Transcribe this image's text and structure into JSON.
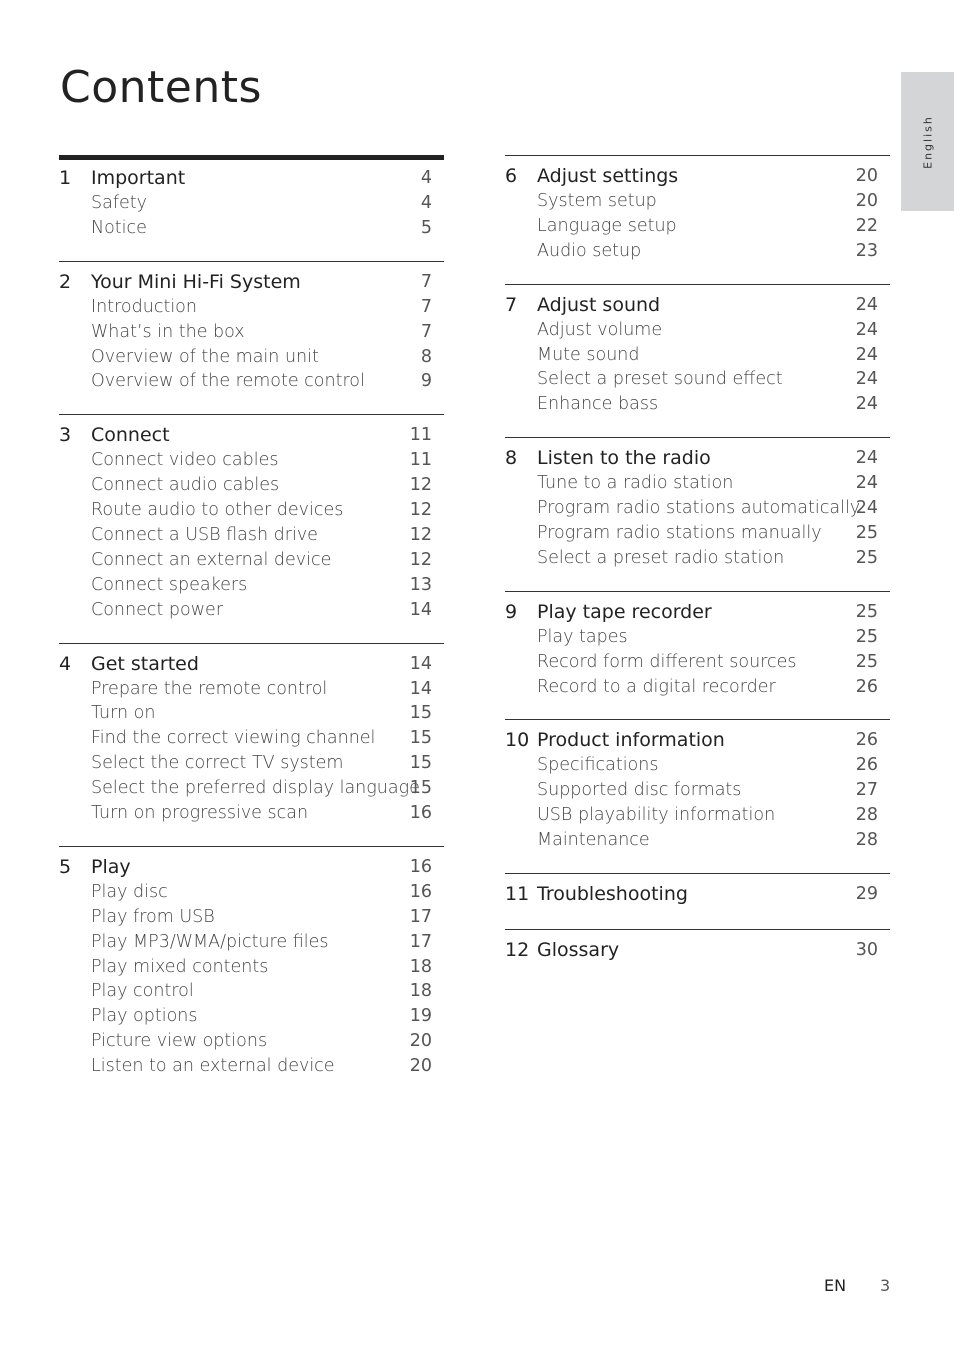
{
  "page": {
    "title": "Contents",
    "language_tab": "English",
    "footer": {
      "language": "EN",
      "page_number": "3"
    }
  },
  "sections": [
    {
      "num": "1",
      "title": "Important",
      "page": "4",
      "items": [
        {
          "title": "Safety",
          "page": "4"
        },
        {
          "title": "Notice",
          "page": "5"
        }
      ]
    },
    {
      "num": "2",
      "title": "Your Mini Hi-Fi System",
      "page": "7",
      "items": [
        {
          "title": "Introduction",
          "page": "7"
        },
        {
          "title": "What’s in the box",
          "page": "7"
        },
        {
          "title": "Overview of the main unit",
          "page": "8"
        },
        {
          "title": "Overview of the remote control",
          "page": "9"
        }
      ]
    },
    {
      "num": "3",
      "title": "Connect",
      "page": "11",
      "items": [
        {
          "title": "Connect video cables",
          "page": "11"
        },
        {
          "title": "Connect audio cables",
          "page": "12"
        },
        {
          "title": "Route audio to other devices",
          "page": "12"
        },
        {
          "title": "Connect a USB flash drive",
          "page": "12"
        },
        {
          "title": "Connect an external device",
          "page": "12"
        },
        {
          "title": "Connect speakers",
          "page": "13"
        },
        {
          "title": "Connect power",
          "page": "14"
        }
      ]
    },
    {
      "num": "4",
      "title": "Get started",
      "page": "14",
      "items": [
        {
          "title": "Prepare the remote control",
          "page": "14"
        },
        {
          "title": "Turn on",
          "page": "15"
        },
        {
          "title": "Find the correct viewing channel",
          "page": "15"
        },
        {
          "title": "Select the correct TV system",
          "page": "15"
        },
        {
          "title": "Select the preferred display language",
          "page": "15"
        },
        {
          "title": "Turn on progressive scan",
          "page": "16"
        }
      ]
    },
    {
      "num": "5",
      "title": "Play",
      "page": "16",
      "items": [
        {
          "title": "Play disc",
          "page": "16"
        },
        {
          "title": "Play from USB",
          "page": "17"
        },
        {
          "title": "Play MP3/WMA/picture files",
          "page": "17"
        },
        {
          "title": "Play mixed contents",
          "page": "18"
        },
        {
          "title": "Play control",
          "page": "18"
        },
        {
          "title": "Play options",
          "page": "19"
        },
        {
          "title": "Picture view options",
          "page": "20"
        },
        {
          "title": "Listen to an external device",
          "page": "20"
        }
      ]
    },
    {
      "num": "6",
      "title": "Adjust settings",
      "page": "20",
      "items": [
        {
          "title": "System setup",
          "page": "20"
        },
        {
          "title": "Language setup",
          "page": "22"
        },
        {
          "title": "Audio setup",
          "page": "23"
        }
      ]
    },
    {
      "num": "7",
      "title": "Adjust sound",
      "page": "24",
      "items": [
        {
          "title": "Adjust volume",
          "page": "24"
        },
        {
          "title": "Mute sound",
          "page": "24"
        },
        {
          "title": "Select a preset sound effect",
          "page": "24"
        },
        {
          "title": "Enhance bass",
          "page": "24"
        }
      ]
    },
    {
      "num": "8",
      "title": "Listen to the radio",
      "page": "24",
      "items": [
        {
          "title": "Tune to a radio station",
          "page": "24"
        },
        {
          "title": "Program radio stations automatically",
          "page": "24"
        },
        {
          "title": "Program radio stations manually",
          "page": "25"
        },
        {
          "title": "Select a preset radio station",
          "page": "25"
        }
      ]
    },
    {
      "num": "9",
      "title": "Play tape recorder",
      "page": "25",
      "items": [
        {
          "title": "Play tapes",
          "page": "25"
        },
        {
          "title": "Record form different sources",
          "page": "25"
        },
        {
          "title": "Record to a digital recorder",
          "page": "26"
        }
      ]
    },
    {
      "num": "10",
      "title": "Product information",
      "page": "26",
      "items": [
        {
          "title": "Specifications",
          "page": "26"
        },
        {
          "title": "Supported disc formats",
          "page": "27"
        },
        {
          "title": "USB playability information",
          "page": "28"
        },
        {
          "title": "Maintenance",
          "page": "28"
        }
      ]
    },
    {
      "num": "11",
      "title": "Troubleshooting",
      "page": "29",
      "items": []
    },
    {
      "num": "12",
      "title": "Glossary",
      "page": "30",
      "items": []
    }
  ]
}
